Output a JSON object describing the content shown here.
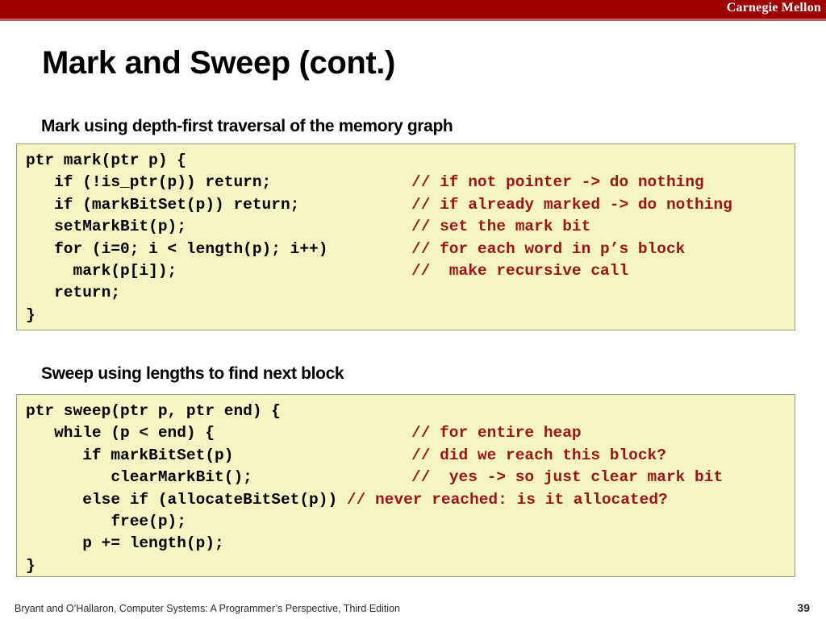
{
  "header": {
    "brand": "Carnegie Mellon",
    "banner_color": "#9e0000",
    "underline_color": "#c16060"
  },
  "slide": {
    "title": "Mark and Sweep (cont.)",
    "page_number": "39",
    "footer": "Bryant and O’Hallaron, Computer Systems: A Programmer’s Perspective, Third Edition"
  },
  "colors": {
    "code_background": "#f5f5c4",
    "code_border": "#9a9a74",
    "code_text": "#000000",
    "code_comment": "#9e1313",
    "title_text": "#000000"
  },
  "sections": [
    {
      "heading": "Mark using depth-first traversal of the memory graph",
      "code_lines": [
        {
          "code": "ptr mark(ptr p) {",
          "comment": ""
        },
        {
          "code": "   if (!is_ptr(p)) return;",
          "comment": "// if not pointer -> do nothing"
        },
        {
          "code": "   if (markBitSet(p)) return;",
          "comment": "// if already marked -> do nothing"
        },
        {
          "code": "   setMarkBit(p);",
          "comment": "// set the mark bit"
        },
        {
          "code": "   for (i=0; i < length(p); i++)",
          "comment": "// for each word in p’s block"
        },
        {
          "code": "     mark(p[i]);",
          "comment": "//  make recursive call"
        },
        {
          "code": "   return;",
          "comment": ""
        },
        {
          "code": "}",
          "comment": ""
        }
      ]
    },
    {
      "heading": "Sweep using lengths to find next block",
      "code_lines": [
        {
          "code": "ptr sweep(ptr p, ptr end) {",
          "comment": ""
        },
        {
          "code": "   while (p < end) {",
          "comment": "// for entire heap"
        },
        {
          "code": "      if markBitSet(p)",
          "comment": "// did we reach this block?"
        },
        {
          "code": "         clearMarkBit();",
          "comment": "//  yes -> so just clear mark bit"
        },
        {
          "code": "      else if (allocateBitSet(p)) ",
          "comment": "// never reached: is it allocated?",
          "inline": true
        },
        {
          "code": "         free(p);",
          "comment": ""
        },
        {
          "code": "      p += length(p);",
          "comment": ""
        },
        {
          "code": "}",
          "comment": ""
        }
      ]
    }
  ]
}
